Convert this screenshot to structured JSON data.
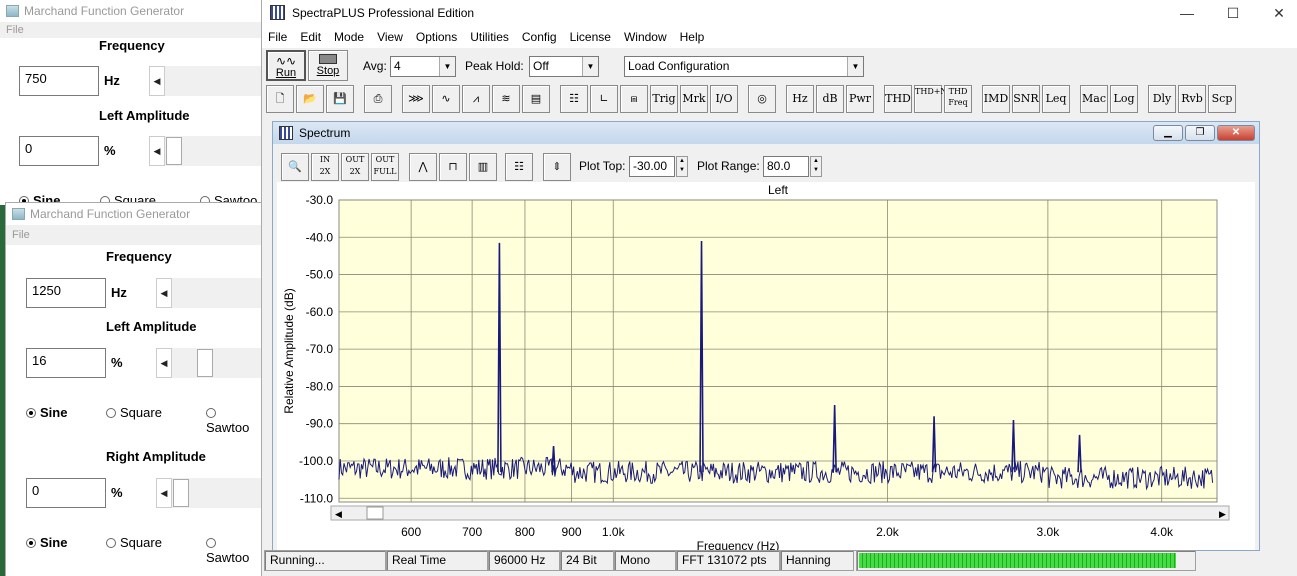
{
  "mfg_back": {
    "title": "Marchand Function Generator",
    "menu": "File",
    "frequency_label": "Frequency",
    "frequency_value": "750",
    "frequency_unit": "Hz",
    "left_amp_label": "Left Amplitude",
    "left_amp_value": "0",
    "left_amp_unit": "%",
    "wave_sine": "Sine",
    "wave_square": "Square",
    "wave_saw": "Sawtoo"
  },
  "mfg_front": {
    "title": "Marchand Function Generator",
    "menu": "File",
    "frequency_label": "Frequency",
    "frequency_value": "1250",
    "frequency_unit": "Hz",
    "left_amp_label": "Left Amplitude",
    "left_amp_value": "16",
    "left_amp_level": 0.3,
    "left_amp_unit": "%",
    "left_wave": {
      "sine": "Sine",
      "square": "Square",
      "saw": "Sawtoo",
      "selected": "sine"
    },
    "right_amp_label": "Right Amplitude",
    "right_amp_value": "0",
    "right_amp_unit": "%",
    "right_wave": {
      "sine": "Sine",
      "square": "Square",
      "saw": "Sawtoo",
      "selected": "sine"
    }
  },
  "spectraplus": {
    "title": "SpectraPLUS Professional Edition",
    "menu": [
      "File",
      "Edit",
      "Mode",
      "View",
      "Options",
      "Utilities",
      "Config",
      "License",
      "Window",
      "Help"
    ],
    "run_label": "Run",
    "stop_label": "Stop",
    "avg_label": "Avg:",
    "avg_value": "4",
    "peakhold_label": "Peak Hold:",
    "peakhold_value": "Off",
    "config_value": "Load Configuration",
    "toolbar_text_buttons": [
      {
        "name": "trig-button",
        "label": "Trig"
      },
      {
        "name": "mrk-button",
        "label": "Mrk"
      },
      {
        "name": "io-button",
        "label": "I/O"
      },
      {
        "name": "hz-button",
        "label": "Hz"
      },
      {
        "name": "db-button",
        "label": "dB"
      },
      {
        "name": "pwr-button",
        "label": "Pwr"
      },
      {
        "name": "thd-button",
        "label": "THD"
      },
      {
        "name": "thdn-button",
        "label": "THD+N"
      },
      {
        "name": "thdfreq-button",
        "label": "THD Freq"
      },
      {
        "name": "imd-button",
        "label": "IMD"
      },
      {
        "name": "snr-button",
        "label": "SNR"
      },
      {
        "name": "leq-button",
        "label": "Leq"
      },
      {
        "name": "mac-button",
        "label": "Mac"
      },
      {
        "name": "log-button",
        "label": "Log"
      },
      {
        "name": "dly-button",
        "label": "Dly"
      },
      {
        "name": "rvb-button",
        "label": "Rvb"
      },
      {
        "name": "scp-button",
        "label": "Scp"
      }
    ],
    "spectrum": {
      "window_title": "Spectrum",
      "plot_top_label": "Plot Top:",
      "plot_top_value": "-30.00",
      "plot_range_label": "Plot Range:",
      "plot_range_value": "80.0"
    },
    "status": [
      "Running...",
      "Real Time",
      "96000 Hz",
      "24 Bit",
      "Mono",
      "FFT 131072 pts",
      "Hanning"
    ],
    "level_meter": 0.95,
    "colors": {
      "plot_bg": "#ffffdc",
      "trace": "#1a1a7a",
      "meter": "#33cc33"
    }
  },
  "chart_data": {
    "type": "line",
    "title": "Left",
    "xlabel": "Frequency (Hz)",
    "ylabel": "Relative Amplitude (dB)",
    "xscale": "log",
    "xlim": [
      500,
      4600
    ],
    "ylim": [
      -111,
      -30
    ],
    "yticks": [
      "-30.0",
      "-40.0",
      "-50.0",
      "-60.0",
      "-70.0",
      "-80.0",
      "-90.0",
      "-100.0",
      "-110.0"
    ],
    "ytick_values": [
      -30,
      -40,
      -50,
      -60,
      -70,
      -80,
      -90,
      -100,
      -110
    ],
    "xticks": [
      "600",
      "700",
      "800",
      "900",
      "1.0k",
      "2.0k",
      "3.0k",
      "4.0k"
    ],
    "xtick_values": [
      600,
      700,
      800,
      900,
      1000,
      2000,
      3000,
      4000
    ],
    "noise_floor": -103,
    "peaks": [
      {
        "x": 750,
        "y": -41.5
      },
      {
        "x": 860,
        "y": -96
      },
      {
        "x": 1250,
        "y": -41
      },
      {
        "x": 1750,
        "y": -85
      },
      {
        "x": 2250,
        "y": -88
      },
      {
        "x": 2750,
        "y": -89
      },
      {
        "x": 3250,
        "y": -93
      }
    ],
    "grid": true
  }
}
